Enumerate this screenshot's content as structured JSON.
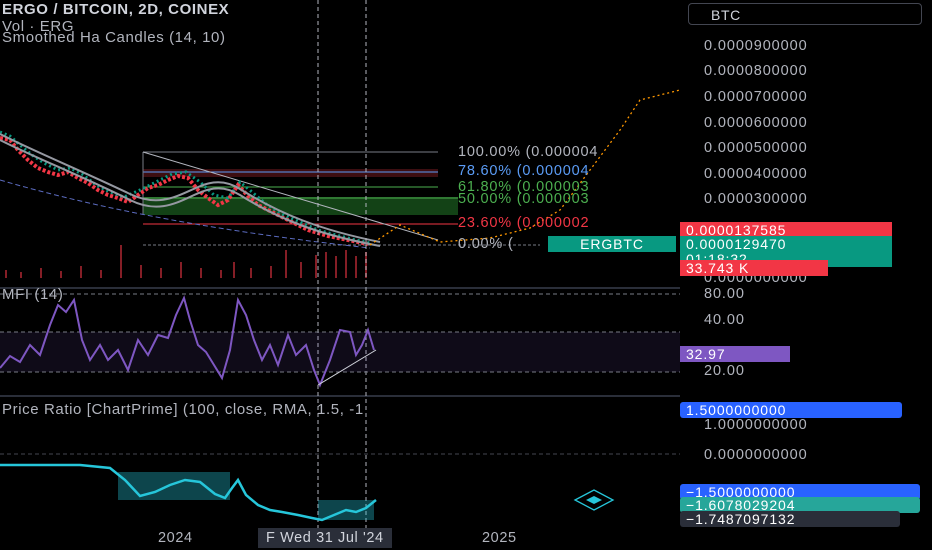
{
  "header": {
    "symbol_line": "ERGO / BITCOIN, 2D, COINEX",
    "volume_line": "Vol · ERG",
    "indicator_line": "Smoothed Ha Candles (14, 10)"
  },
  "symbol_box": "BTC",
  "price_axis": {
    "labels": [
      "0.0000900000",
      "0.0000800000",
      "0.0000700000",
      "0.0000600000",
      "0.0000500000",
      "0.0000400000",
      "0.0000300000",
      "0.0000000000"
    ],
    "last_price_red": "0.0000137585",
    "ticker_tag": "ERGBTC",
    "current_price": "0.0000129470",
    "countdown": "01:18:32",
    "volume_value": "33.743 K"
  },
  "fib_levels": [
    {
      "label": "100.00% (0.000004",
      "color": "#b2b5be"
    },
    {
      "label": "78.60% (0.000004",
      "color": "#5b9cf6"
    },
    {
      "label": "61.80% (0.000003",
      "color": "#4caf50"
    },
    {
      "label": "50.00% (0.000003",
      "color": "#4caf50"
    },
    {
      "label": "23.60% (0.000002",
      "color": "#f23645"
    },
    {
      "label": "0.00% (",
      "color": "#b2b5be"
    }
  ],
  "mfi": {
    "title": "MFI (14)",
    "axis": [
      "80.00",
      "40.00",
      "20.00"
    ],
    "value": "32.97",
    "value_color": "#7e57c2"
  },
  "price_ratio": {
    "title": "Price Ratio [ChartPrime] (100, close, RMA, 1.5, -1",
    "axis": [
      "1.0000000000",
      "0.0000000000"
    ],
    "upper_badge": "1.5000000000",
    "lower_badge": "−1.5000000000",
    "value_badge": "−1.6078029204",
    "extra_badge": "−1.7487097132"
  },
  "time_axis": {
    "left_label": "2024",
    "crosshair_date": "F    Wed 31 Jul '24",
    "right_label": "2025"
  },
  "colors": {
    "background": "#000000",
    "bull": "#089981",
    "bear": "#f23645",
    "mfi_line": "#7e57c2",
    "ratio_line": "#26c6da",
    "accent_blue": "#2962ff"
  }
}
